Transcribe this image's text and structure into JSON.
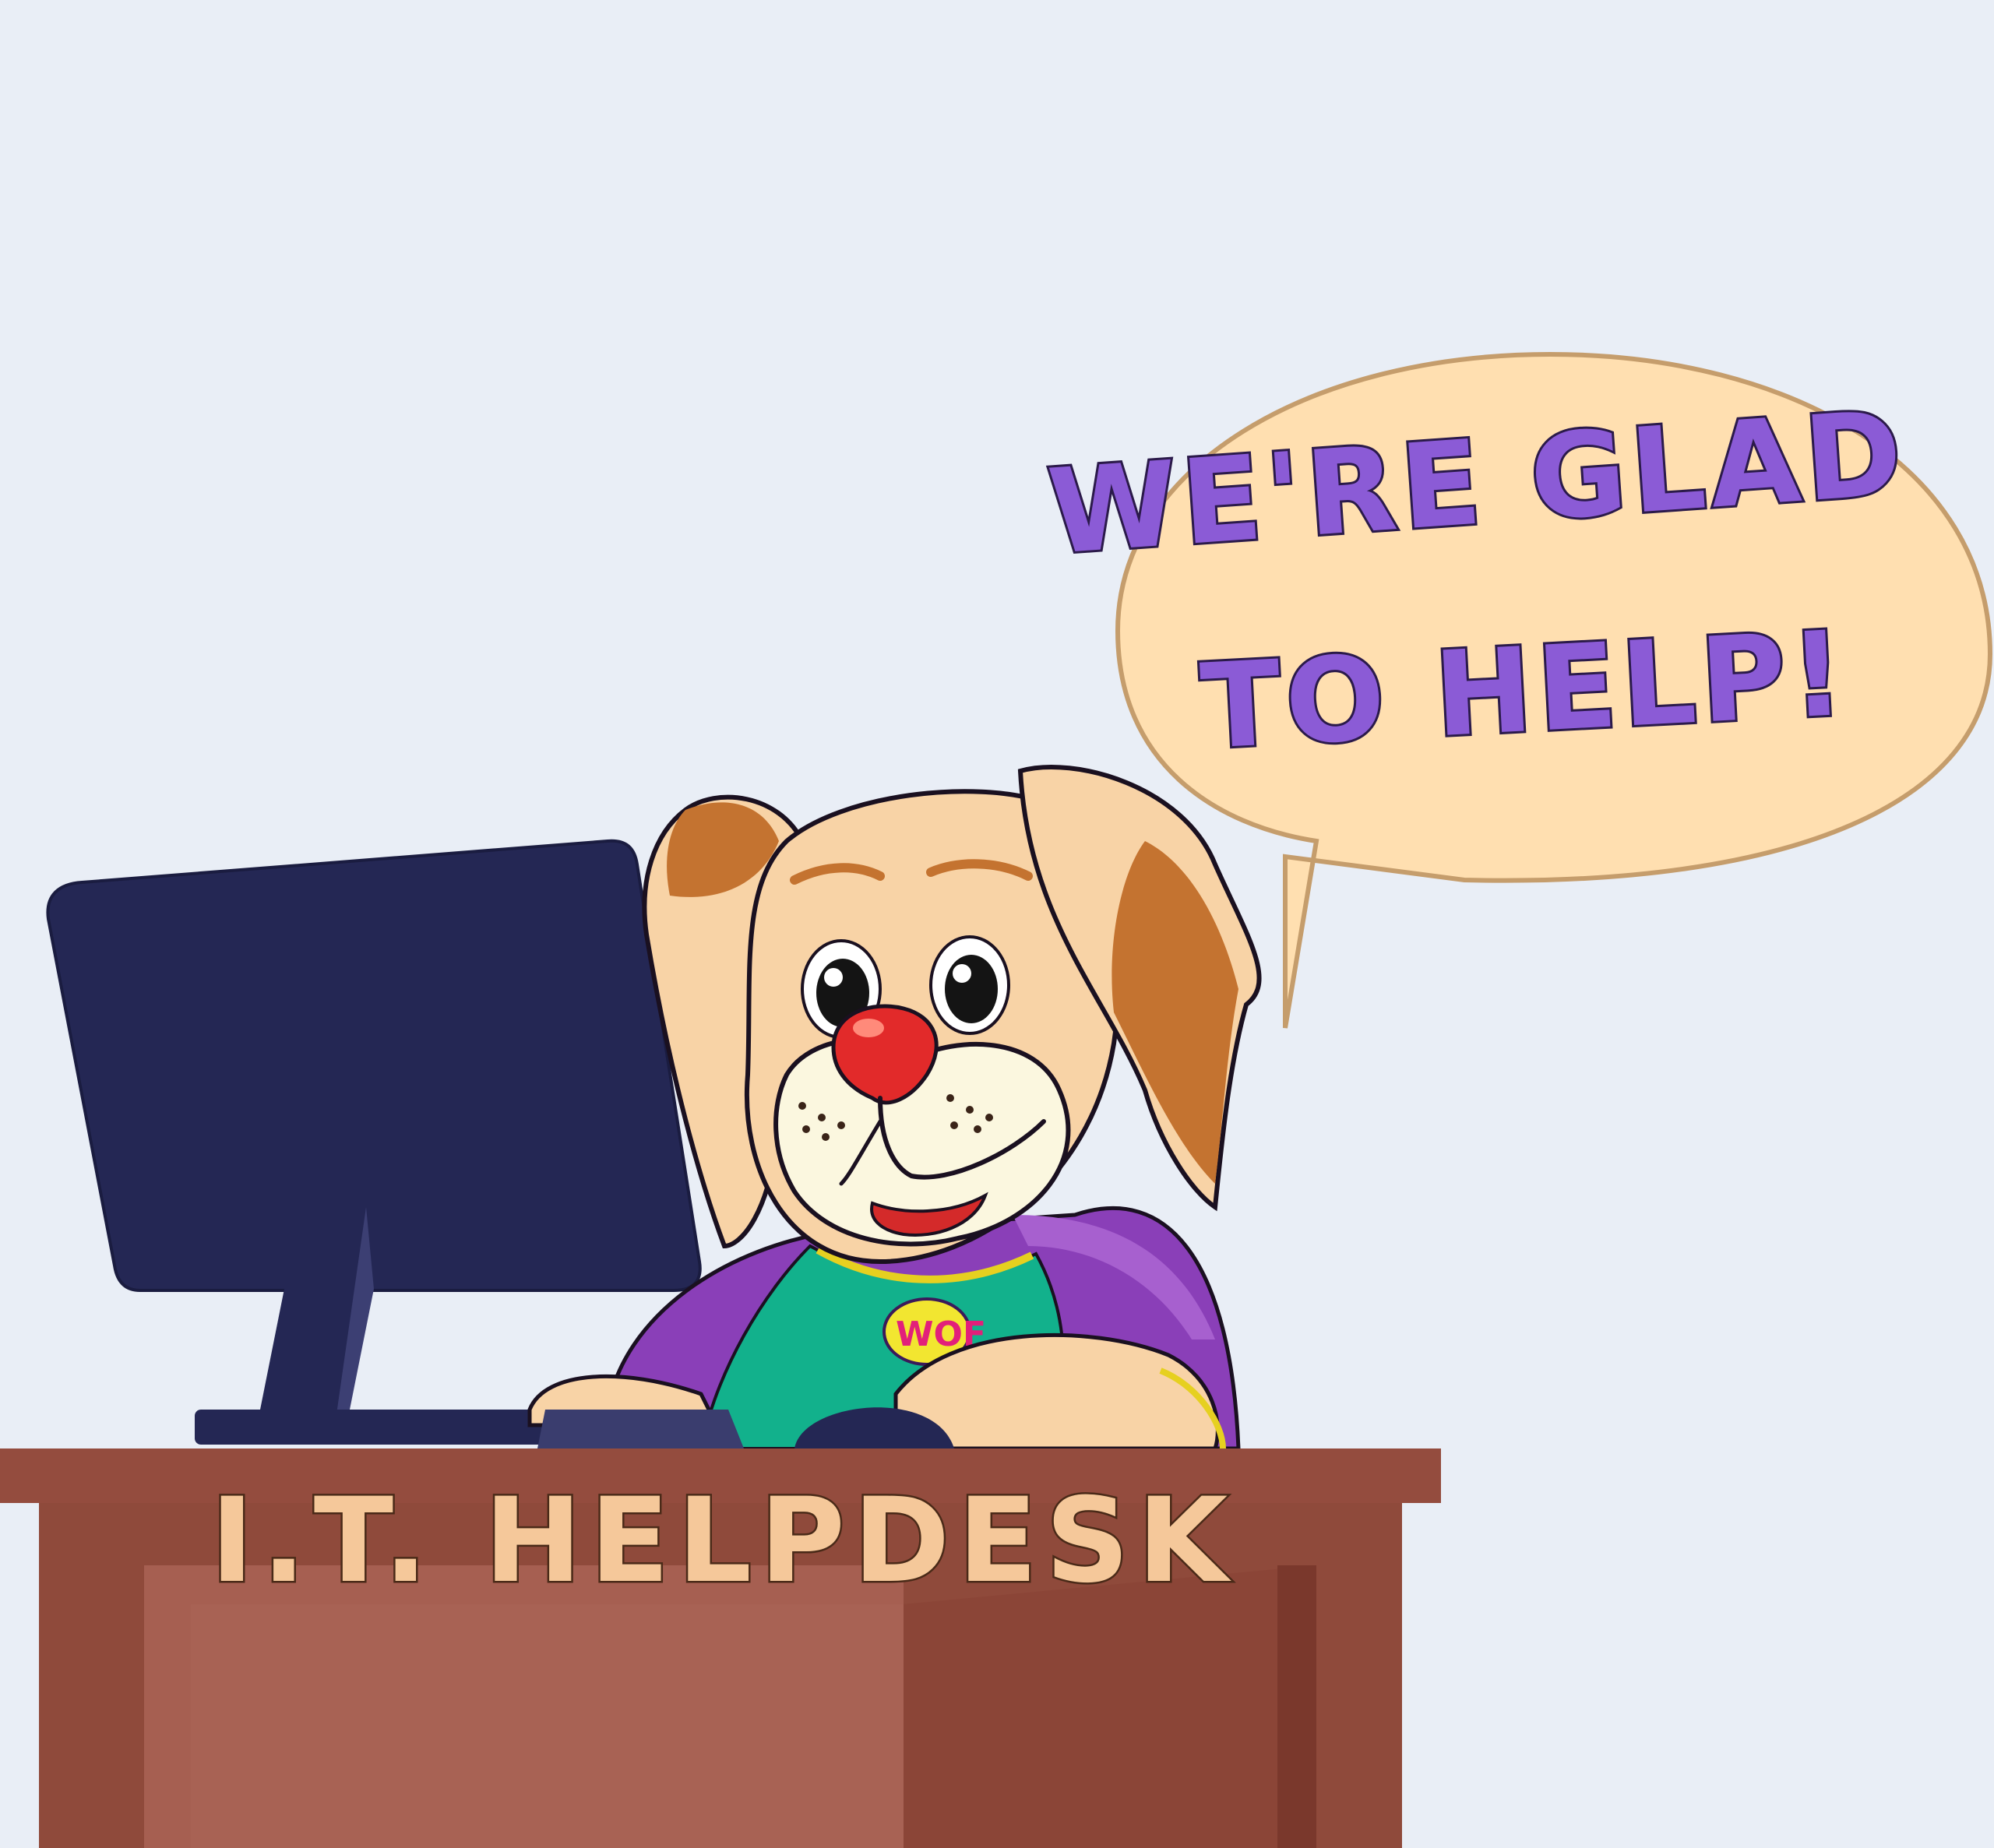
{
  "speech_bubble": {
    "line1": "WE'RE GLAD",
    "line2": "TO HELP!"
  },
  "desk": {
    "sign": "I.T. HELPDESK"
  },
  "shirt_logo": "WOF",
  "colors": {
    "background": "#e9eef6",
    "bubble_fill": "#ffdfb0",
    "bubble_text": "#8b5bd6",
    "monitor": "#242754",
    "desk_top": "#944c3e",
    "desk_front": "#a65f51",
    "dog_fur": "#f8d3a6",
    "dog_spots": "#c47330",
    "dog_muzzle": "#fbf7df",
    "nose": "#e22a2a",
    "shirt": "#12b18c",
    "jacket": "#8a3fb8"
  }
}
